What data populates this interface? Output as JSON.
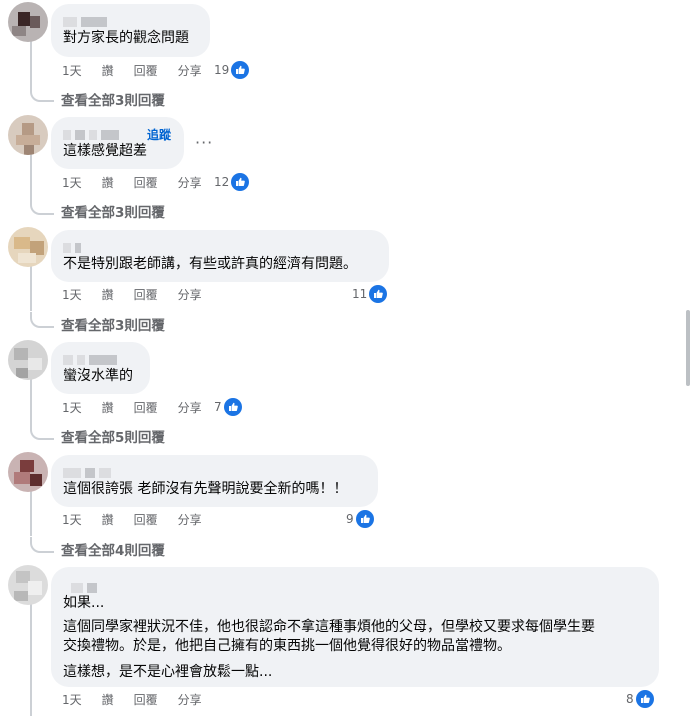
{
  "comments": [
    {
      "text": "對方家長的觀念問題",
      "time": "1天",
      "like": "讚",
      "reply": "回覆",
      "share": "分享",
      "reactions": "19",
      "view_replies": "查看全部3則回覆"
    },
    {
      "text": "這樣感覺超差",
      "follow": "追蹤",
      "more": "···",
      "time": "1天",
      "like": "讚",
      "reply": "回覆",
      "share": "分享",
      "reactions": "12",
      "view_replies": "查看全部3則回覆"
    },
    {
      "text": "不是特別跟老師講，有些或許真的經濟有問題。",
      "time": "1天",
      "like": "讚",
      "reply": "回覆",
      "share": "分享",
      "reactions": "11",
      "view_replies": "查看全部3則回覆"
    },
    {
      "text": "蠻沒水準的",
      "time": "1天",
      "like": "讚",
      "reply": "回覆",
      "share": "分享",
      "reactions": "7",
      "view_replies": "查看全部5則回覆"
    },
    {
      "text": "這個很誇張 老師沒有先聲明說要全新的嗎！！",
      "time": "1天",
      "like": "讚",
      "reply": "回覆",
      "share": "分享",
      "reactions": "9",
      "view_replies": "查看全部4則回覆"
    },
    {
      "lines": [
        "如果...",
        "這個同學家裡狀況不佳，他也很認命不拿這種事煩他的父母，但學校又要求每個學生要",
        "交換禮物。於是，他把自己擁有的東西挑一個他覺得很好的物品當禮物。",
        "這樣想，是不是心裡會放鬆一點..."
      ],
      "time": "1天",
      "like": "讚",
      "reply": "回覆",
      "share": "分享",
      "reactions": "8"
    }
  ],
  "colors": {
    "bubble": "#f0f2f5",
    "meta": "#65676b",
    "like": "#1b74e4",
    "follow": "#0064d1"
  }
}
